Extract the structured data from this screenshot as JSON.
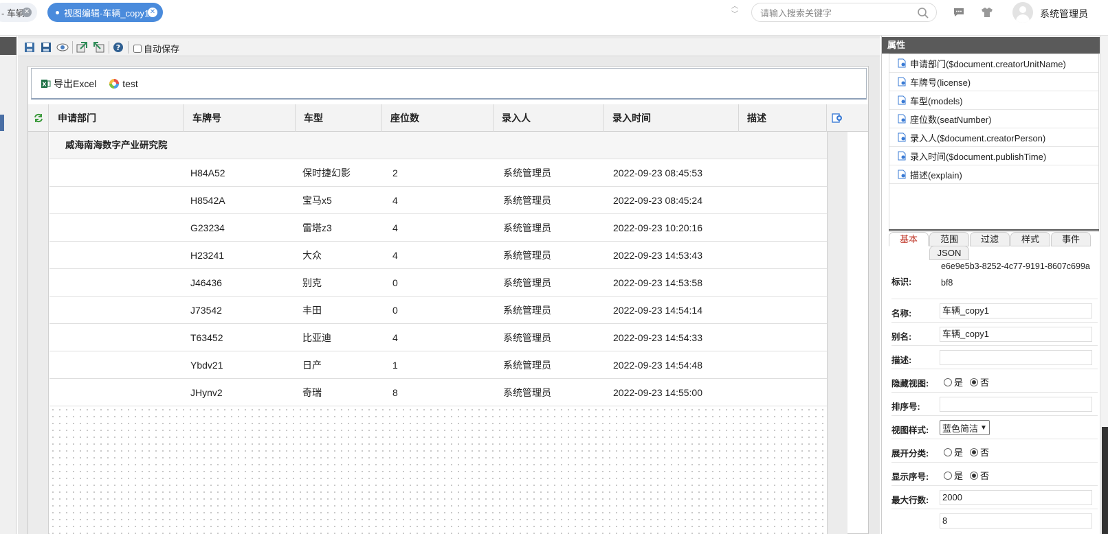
{
  "tabs": [
    {
      "label": "- 车辆",
      "active": false
    },
    {
      "label": "视图编辑-车辆_copy1",
      "active": true
    }
  ],
  "search": {
    "placeholder": "请输入搜索关键字"
  },
  "user": {
    "name": "系统管理员"
  },
  "toolbar": {
    "autosave_label": "自动保存"
  },
  "actions": [
    {
      "label": "导出Excel",
      "icon": "excel-icon"
    },
    {
      "label": "test",
      "icon": "color-wheel-icon"
    }
  ],
  "columns": [
    "申请部门",
    "车牌号",
    "车型",
    "座位数",
    "录入人",
    "录入时间",
    "描述"
  ],
  "group": {
    "label": "威海南海数字产业研究院"
  },
  "rows": [
    [
      "",
      "H84A52",
      "保时捷幻影",
      "2",
      "系统管理员",
      "2022-09-23 08:45:53",
      ""
    ],
    [
      "",
      "H8542A",
      "宝马x5",
      "4",
      "系统管理员",
      "2022-09-23 08:45:24",
      ""
    ],
    [
      "",
      "G23234",
      "雷塔z3",
      "4",
      "系统管理员",
      "2022-09-23 10:20:16",
      ""
    ],
    [
      "",
      "H23241",
      "大众",
      "4",
      "系统管理员",
      "2022-09-23 14:53:43",
      ""
    ],
    [
      "",
      "J46436",
      "别克",
      "0",
      "系统管理员",
      "2022-09-23 14:53:58",
      ""
    ],
    [
      "",
      "J73542",
      "丰田",
      "0",
      "系统管理员",
      "2022-09-23 14:54:14",
      ""
    ],
    [
      "",
      "T63452",
      "比亚迪",
      "4",
      "系统管理员",
      "2022-09-23 14:54:33",
      ""
    ],
    [
      "",
      "Ybdv21",
      "日产",
      "1",
      "系统管理员",
      "2022-09-23 14:54:48",
      ""
    ],
    [
      "",
      "JHynv2",
      "奇瑞",
      "8",
      "系统管理员",
      "2022-09-23 14:55:00",
      ""
    ]
  ],
  "panel": {
    "title": "属性",
    "fields": [
      "申请部门($document.creatorUnitName)",
      "车牌号(license)",
      "车型(models)",
      "座位数(seatNumber)",
      "录入人($document.creatorPerson)",
      "录入时间($document.publishTime)",
      "描述(explain)"
    ],
    "tabs": [
      "基本",
      "范围",
      "过滤",
      "样式",
      "事件",
      "JSON"
    ],
    "props": {
      "id_label": "标识:",
      "id_value": "e6e9e5b3-8252-4c77-9191-8607c699abf8",
      "name_label": "名称:",
      "name_value": "车辆_copy1",
      "alias_label": "别名:",
      "alias_value": "车辆_copy1",
      "desc_label": "描述:",
      "desc_value": "",
      "hidden_label": "隐藏视图:",
      "order_label": "排序号:",
      "order_value": "",
      "style_label": "视图样式:",
      "style_value": "蓝色简洁",
      "expand_label": "展开分类:",
      "seq_label": "显示序号:",
      "maxrows_label": "最大行数:",
      "maxrows_value": "2000",
      "last_value": "8",
      "yes": "是",
      "no": "否"
    }
  }
}
